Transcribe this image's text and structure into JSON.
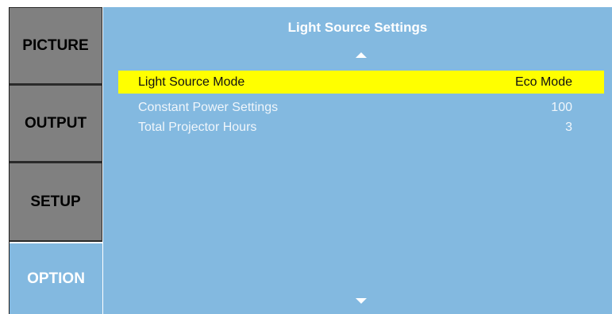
{
  "sidebar": {
    "tabs": [
      {
        "label": "PICTURE",
        "active": false
      },
      {
        "label": "OUTPUT",
        "active": false
      },
      {
        "label": "SETUP",
        "active": false
      },
      {
        "label": "OPTION",
        "active": true
      }
    ]
  },
  "panel": {
    "title": "Light Source Settings",
    "rows": [
      {
        "label": "Light Source Mode",
        "value": "Eco Mode",
        "selected": true
      },
      {
        "label": "Constant Power Settings",
        "value": "100",
        "selected": false
      },
      {
        "label": "Total Projector Hours",
        "value": "3",
        "selected": false
      }
    ]
  },
  "icons": {
    "scroll_up": "arrow-up-icon",
    "scroll_down": "arrow-down-icon"
  },
  "colors": {
    "panel_bg": "#83b9e0",
    "tab_bg": "#808080",
    "highlight": "#ffff00",
    "text_light": "#ffffff"
  }
}
